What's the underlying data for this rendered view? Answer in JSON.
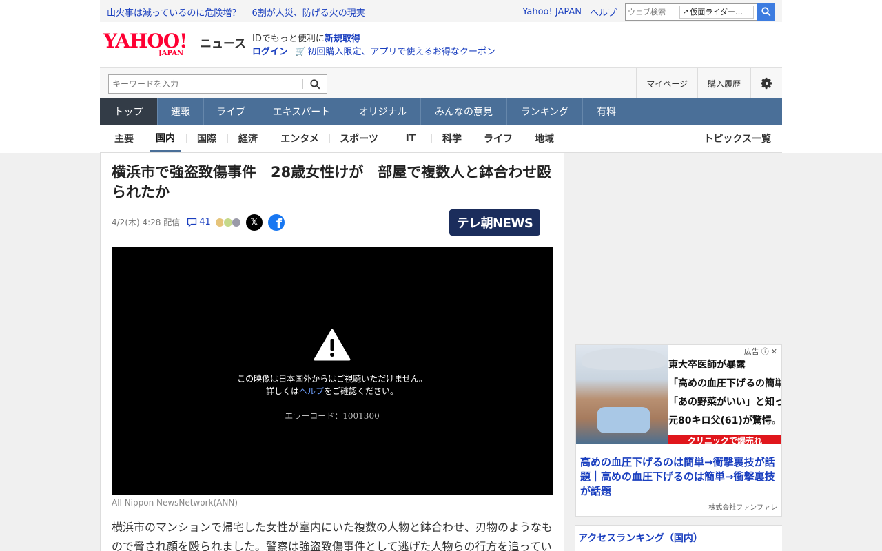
{
  "top_links": {
    "item1": "山火事は減っているのに危険増？",
    "item2": "6割が人災、防げる火の現実"
  },
  "top_right": {
    "yahoo_japan": "Yahoo! JAPAN",
    "help": "ヘルプ",
    "web_search_placeholder": "ウェブ検索",
    "suggestion": "仮面ライダー…"
  },
  "logo": {
    "yahoo": "YAHOO!",
    "japan": "JAPAN",
    "news": "ニュース"
  },
  "id_area": {
    "line1_prefix": "IDでもっと便利に",
    "signup": "新規取得",
    "login": "ログイン",
    "coupon": "初回購入限定、アプリで使えるお得なクーポン"
  },
  "search": {
    "placeholder": "キーワードを入力"
  },
  "utility": {
    "mypage": "マイページ",
    "purchase_history": "購入履歴"
  },
  "main_nav": [
    {
      "label": "トップ",
      "active": true
    },
    {
      "label": "速報"
    },
    {
      "label": "ライブ"
    },
    {
      "label": "エキスパート"
    },
    {
      "label": "オリジナル"
    },
    {
      "label": "みんなの意見"
    },
    {
      "label": "ランキング"
    },
    {
      "label": "有料"
    }
  ],
  "sub_nav": [
    {
      "label": "主要"
    },
    {
      "label": "国内",
      "active": true
    },
    {
      "label": "国際"
    },
    {
      "label": "経済"
    },
    {
      "label": "エンタメ"
    },
    {
      "label": "スポーツ"
    },
    {
      "label": "IT"
    },
    {
      "label": "科学"
    },
    {
      "label": "ライフ"
    },
    {
      "label": "地域"
    }
  ],
  "topics_link": "トピックス一覧",
  "article": {
    "headline": "横浜市で強盗致傷事件　28歳女性けが　部屋で複数人と鉢合わせ殴られたか",
    "date": "4/2(木) 4:28 配信",
    "comments": "41",
    "publisher_logo": "テレ朝NEWS",
    "video_msg1": "この映像は日本国外からはご視聴いただけません。",
    "video_msg2_pre": "詳しくは",
    "video_msg2_link": "ヘルプ",
    "video_msg2_post": "をご確認ください。",
    "video_error": "エラーコード：1001300",
    "credit": "All Nippon NewsNetwork(ANN)",
    "body": "横浜市のマンションで帰宅した女性が室内にいた複数の人物と鉢合わせ、刃物のようなもので脅され顔を殴られました。警察は強盗致傷事件として逃げた人物らの行方を追っています。"
  },
  "ad": {
    "label": "広告",
    "image_lines": [
      "東大卒医師が暴露",
      "「高めの血圧下げるの簡単」",
      "「あの野菜がいい」と知った",
      "元80キロ父(61)が驚愕。"
    ],
    "image_banner": "クリニックで爆売れ",
    "title": "高めの血圧下げるのは簡単→衝撃裏技が話題｜高めの血圧下げるのは簡単→衝撃裏技が話題",
    "sponsor": "株式会社ファンファレ"
  },
  "ranking_title": "アクセスランキング（国内）",
  "colors": {
    "nav_bg": "#4a6f98",
    "nav_active": "#333c47",
    "link": "#1a3fbf",
    "yahoo_red": "#ff0033"
  }
}
